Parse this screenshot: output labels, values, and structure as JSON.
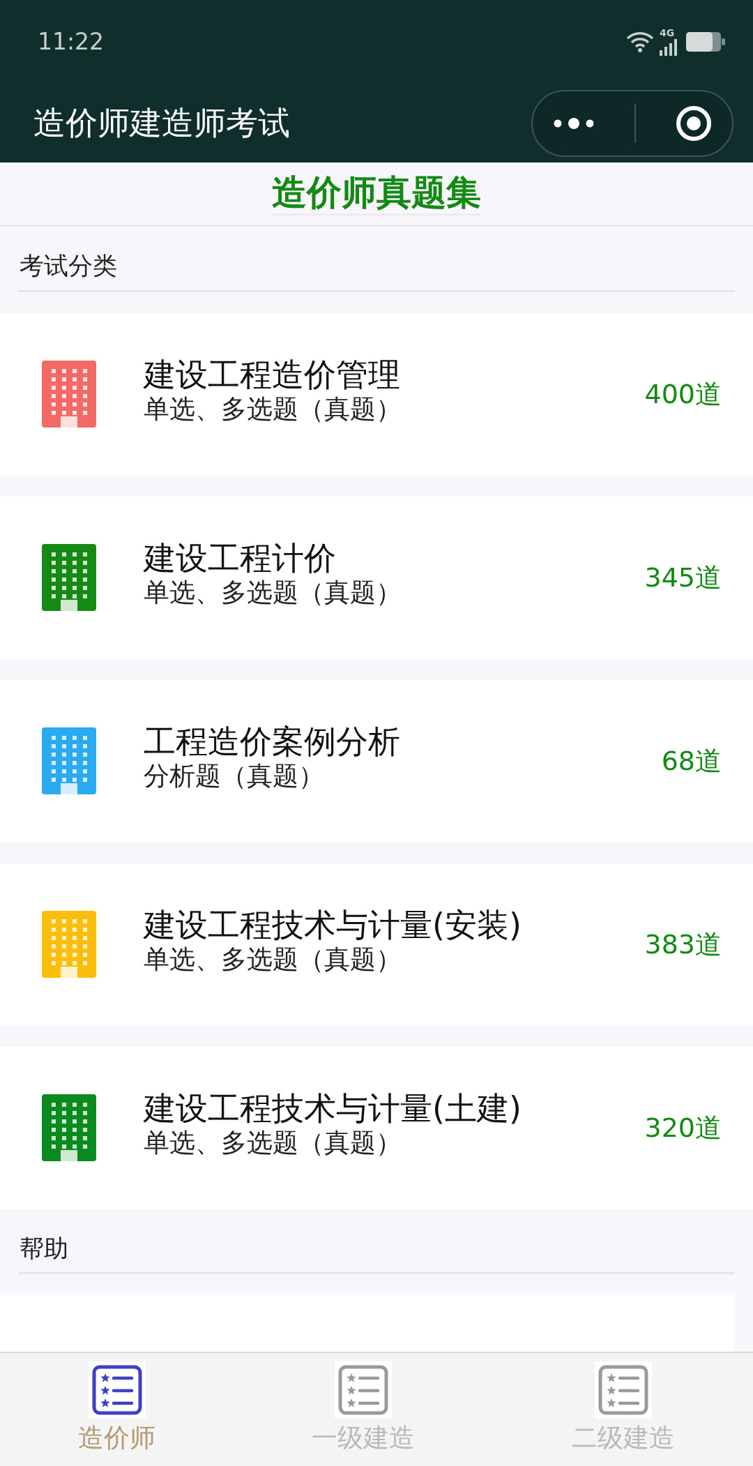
{
  "status_bar": {
    "time": "11:22",
    "network": "4G"
  },
  "header": {
    "title": "造价师建造师考试"
  },
  "page_title": "造价师真题集",
  "categories": {
    "label": "考试分类",
    "items": [
      {
        "title": "建设工程造价管理",
        "subtitle": "单选、多选题（真题）",
        "count": "400道",
        "color": "#f26a66"
      },
      {
        "title": "建设工程计价",
        "subtitle": "单选、多选题（真题）",
        "count": "345道",
        "color": "#158a15"
      },
      {
        "title": "工程造价案例分析",
        "subtitle": "分析题（真题）",
        "count": "68道",
        "color": "#2aaaf0"
      },
      {
        "title": "建设工程技术与计量(安装)",
        "subtitle": "单选、多选题（真题）",
        "count": "383道",
        "color": "#fbbe0d"
      },
      {
        "title": "建设工程技术与计量(土建)",
        "subtitle": "单选、多选题（真题）",
        "count": "320道",
        "color": "#0b8a20"
      }
    ]
  },
  "help": {
    "label": "帮助"
  },
  "tab_bar": [
    {
      "label": "造价师",
      "selected": true
    },
    {
      "label": "一级建造",
      "selected": false
    },
    {
      "label": "二级建造",
      "selected": false
    }
  ]
}
